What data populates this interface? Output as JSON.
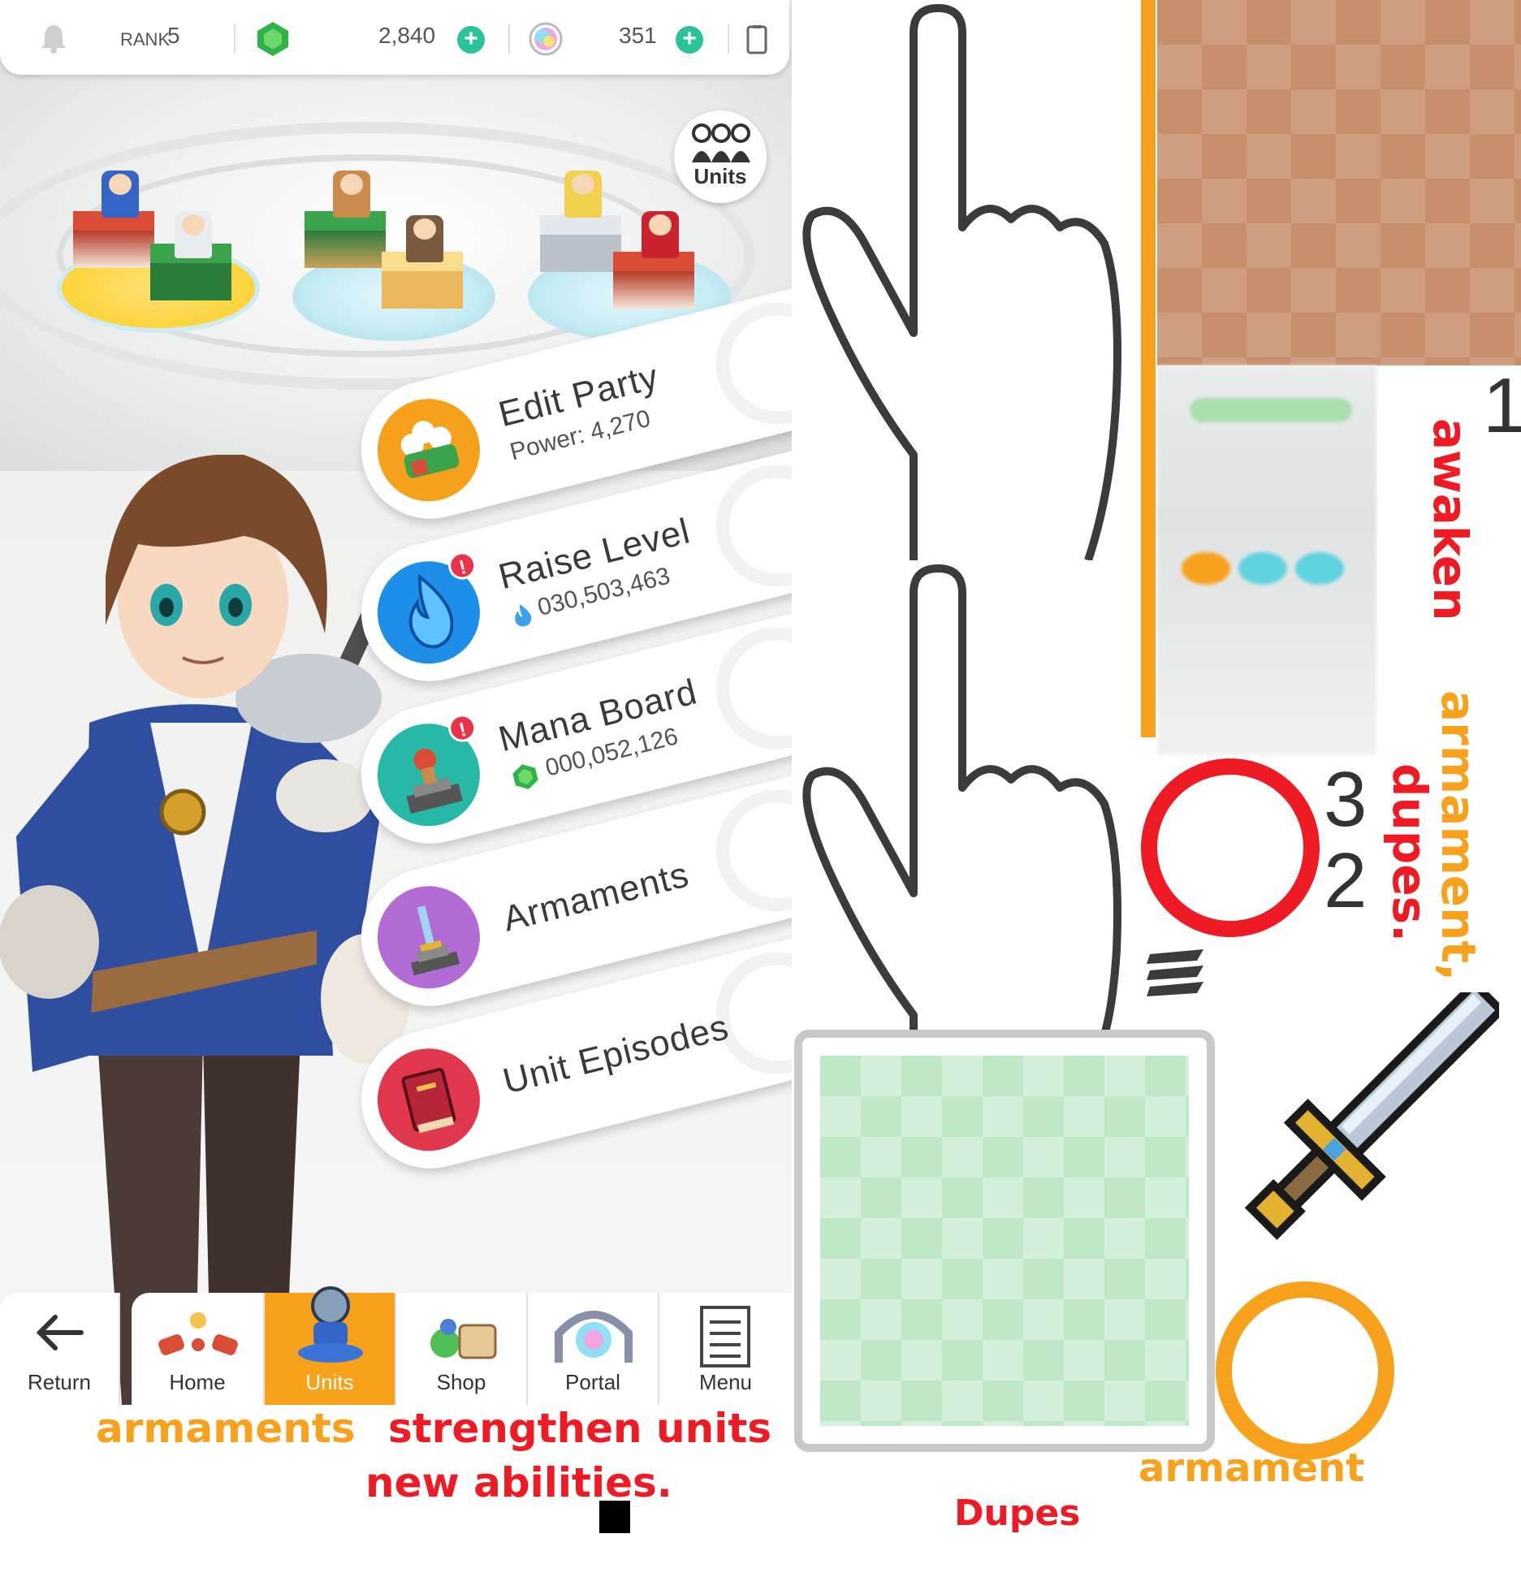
{
  "topbar": {
    "rank_label": "RANK",
    "rank_value": "5",
    "gems": "2,840",
    "orbs": "351",
    "icons": [
      "bell-icon",
      "green-gem-icon",
      "rainbow-orb-icon",
      "phone-icon"
    ]
  },
  "units_button": {
    "label": "Units"
  },
  "menu": [
    {
      "title": "Edit Party",
      "sub": "Power: 4,270",
      "color": "#f5a11c",
      "icon": "party-icon",
      "badge": ""
    },
    {
      "title": "Raise Level",
      "sub": "030,503,463",
      "color": "#1e8fe8",
      "icon": "flame-icon",
      "badge": "!"
    },
    {
      "title": "Mana Board",
      "sub": "000,052,126",
      "color": "#28b8a6",
      "icon": "mana-board-icon",
      "badge": "!"
    },
    {
      "title": "Armaments",
      "sub": "",
      "color": "#b36cd6",
      "icon": "sword-icon",
      "badge": ""
    },
    {
      "title": "Unit Episodes",
      "sub": "",
      "color": "#e0374d",
      "icon": "book-icon",
      "badge": ""
    }
  ],
  "nav": {
    "return": "Return",
    "home": "Home",
    "units": "Units",
    "shop": "Shop",
    "portal": "Portal",
    "menu": "Menu"
  },
  "captions": {
    "armaments": "armaments",
    "strengthen": "strengthen units",
    "new_abilities": "new abilities.",
    "awaken": "awaken",
    "armament_dupes_1": "armament,",
    "armament_dupes_2": "dupes.",
    "armament": "armament",
    "dupes": "Dupes"
  },
  "digits": {
    "one": "1",
    "three": "3",
    "two": "2"
  },
  "colors": {
    "accent_orange": "#f7a11c",
    "caption_red": "#ee1b24",
    "caption_orange": "#f7a11c",
    "plus_green": "#2bc39a"
  }
}
